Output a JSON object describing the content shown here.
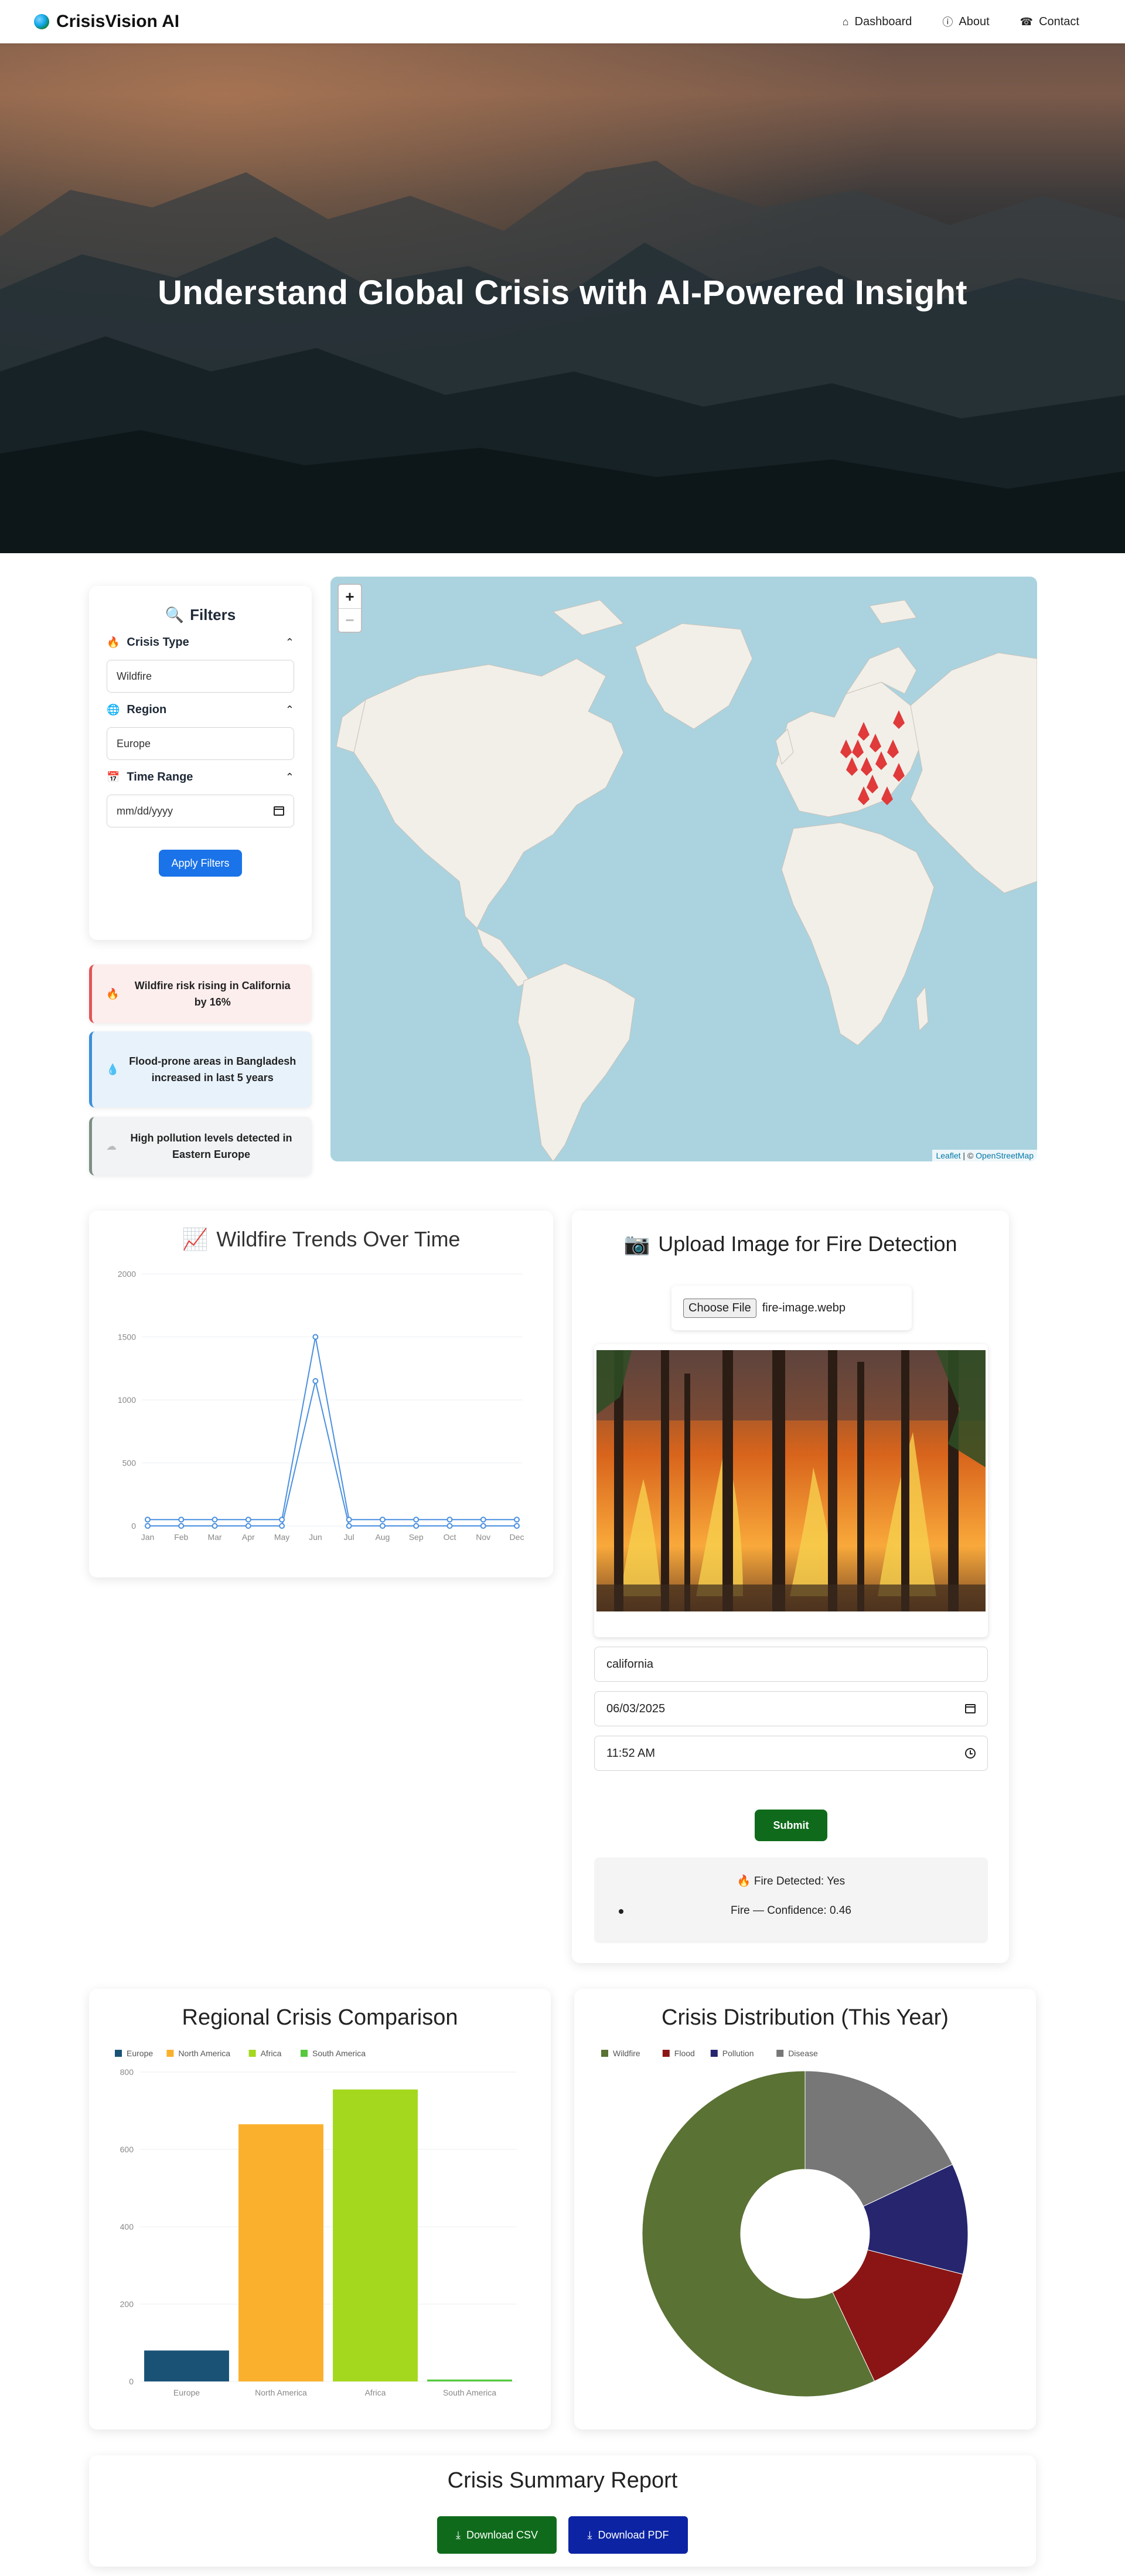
{
  "navbar": {
    "brand": "CrisisVision AI",
    "links": [
      {
        "label": "Dashboard",
        "icon": "home-icon"
      },
      {
        "label": "About",
        "icon": "info-icon"
      },
      {
        "label": "Contact",
        "icon": "phone-icon"
      }
    ]
  },
  "hero": {
    "title": "Understand Global Crisis with AI-Powered Insight"
  },
  "filters": {
    "title": "Filters",
    "crisis_type": {
      "label": "Crisis Type",
      "value": "Wildfire"
    },
    "region": {
      "label": "Region",
      "value": "Europe"
    },
    "time_range": {
      "label": "Time Range",
      "placeholder": "mm/dd/yyyy"
    },
    "apply_label": "Apply Filters"
  },
  "alerts": [
    {
      "text": "Wildfire risk rising in California by 16%",
      "icon": "fire-icon"
    },
    {
      "text": "Flood-prone areas in Bangladesh increased in last 5 years",
      "icon": "droplet-icon"
    },
    {
      "text": "High pollution levels detected in Eastern Europe",
      "icon": "smog-icon"
    }
  ],
  "map": {
    "zoom_in": "+",
    "zoom_out": "−",
    "attribution_leaflet": "Leaflet",
    "attribution_sep": " | © ",
    "attribution_osm": "OpenStreetMap"
  },
  "trend": {
    "title": "Wildfire Trends Over Time",
    "icon": "chart-increasing-icon"
  },
  "upload": {
    "title": "Upload Image for Fire Detection",
    "icon": "camera-icon",
    "file_button": "Choose File",
    "file_name": "fire-image.webp",
    "location_value": "california",
    "date_value": "06/03/2025",
    "time_value": "11:52 AM",
    "submit_label": "Submit",
    "result_heading": "Fire Detected: Yes",
    "result_item": "Fire — Confidence: 0.46"
  },
  "regional": {
    "title": "Regional Crisis Comparison"
  },
  "distribution": {
    "title": "Crisis Distribution (This Year)"
  },
  "summary": {
    "title": "Crisis Summary Report",
    "csv_label": "Download CSV",
    "pdf_label": "Download PDF"
  },
  "chart_data": [
    {
      "type": "line",
      "title": "Wildfire Trends Over Time",
      "categories": [
        "Jan",
        "Feb",
        "Mar",
        "Apr",
        "May",
        "Jun",
        "Jul",
        "Aug",
        "Sep",
        "Oct",
        "Nov",
        "Dec"
      ],
      "series": [
        {
          "values": [
            0,
            0,
            0,
            0,
            0,
            1150,
            0,
            0,
            0,
            0,
            0,
            0
          ],
          "color": "#4a8fe0"
        },
        {
          "values": [
            50,
            50,
            50,
            50,
            50,
            1500,
            50,
            50,
            50,
            50,
            50,
            50
          ],
          "color": "#4a8fe0"
        }
      ],
      "ylim": [
        0,
        2000
      ],
      "yticks": [
        0,
        500,
        1000,
        1500,
        2000
      ],
      "grid": true
    },
    {
      "type": "bar",
      "title": "Regional Crisis Comparison",
      "categories": [
        "Europe",
        "North America",
        "Africa",
        "South America"
      ],
      "series": [
        {
          "name": "Europe",
          "color": "#1a5276"
        },
        {
          "name": "North America",
          "color": "#fbb02d"
        },
        {
          "name": "Africa",
          "color": "#a4d81e"
        },
        {
          "name": "South America",
          "color": "#56c93f"
        }
      ],
      "values": [
        80,
        665,
        755,
        5
      ],
      "colors": [
        "#1a5276",
        "#fbb02d",
        "#a4d81e",
        "#56c93f"
      ],
      "ylim": [
        0,
        800
      ],
      "yticks": [
        0,
        200,
        400,
        600,
        800
      ],
      "legend": "top-left"
    },
    {
      "type": "pie",
      "title": "Crisis Distribution (This Year)",
      "labels": [
        "Wildfire",
        "Flood",
        "Pollution",
        "Disease"
      ],
      "values": [
        57,
        14,
        11,
        18
      ],
      "colors": [
        "#5a7234",
        "#8b1515",
        "#26256e",
        "#777777"
      ],
      "legend": "top-left",
      "donut": true
    }
  ]
}
